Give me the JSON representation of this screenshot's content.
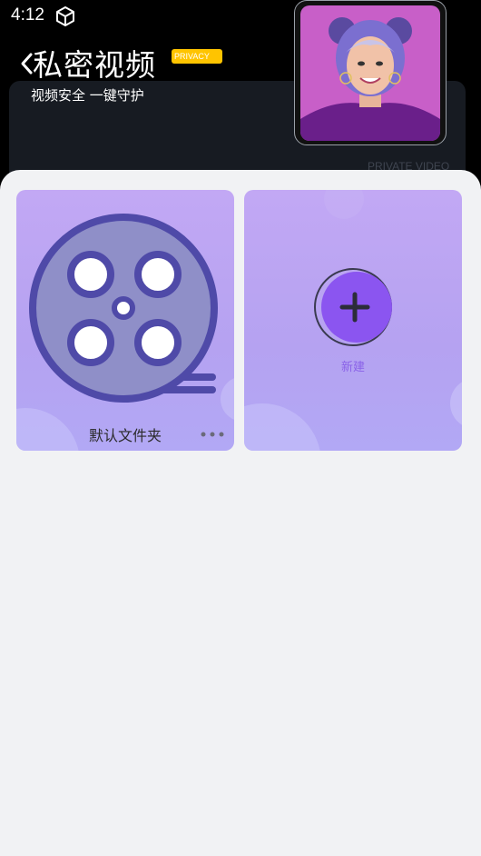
{
  "status_bar": {
    "time": "4:12"
  },
  "header": {
    "title": "私密视频",
    "badge": "PRIVACY",
    "subtitle": "视频安全 一键守护",
    "watermark": "PRIVATE VIDEO"
  },
  "folders": [
    {
      "name": "默认文件夹"
    }
  ],
  "new_folder": {
    "label": "新建"
  },
  "colors": {
    "accent": "#8a62e8",
    "badge": "#ffc400",
    "card_gradient_top": "#c2a8f4",
    "reel": "#4f4aa8"
  }
}
